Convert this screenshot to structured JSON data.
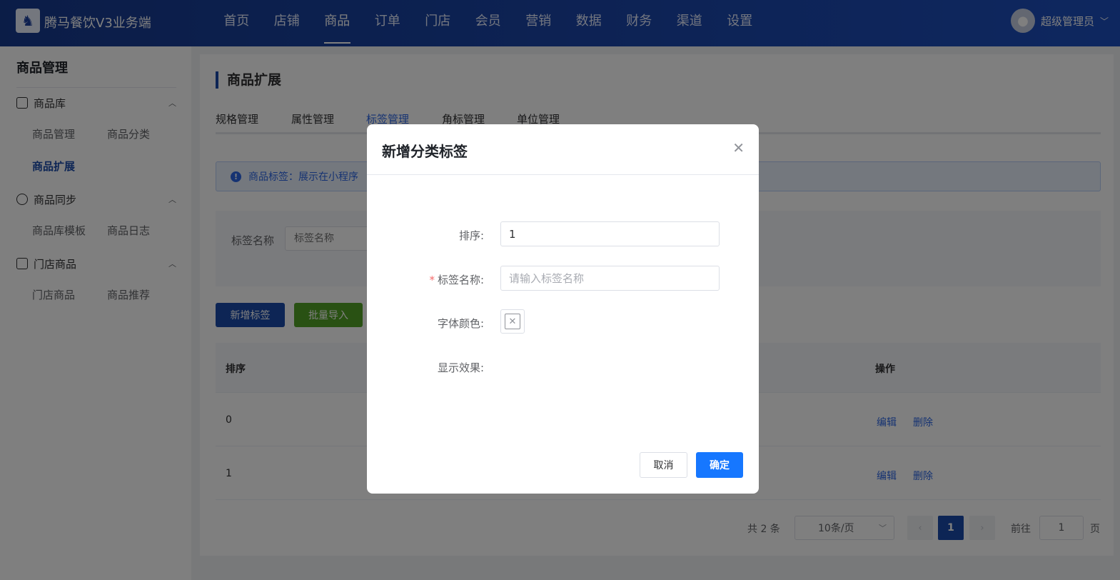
{
  "header": {
    "app_title": "腾马餐饮V3业务端",
    "nav": [
      {
        "label": "首页",
        "active": false
      },
      {
        "label": "店铺",
        "active": false
      },
      {
        "label": "商品",
        "active": true
      },
      {
        "label": "订单",
        "active": false
      },
      {
        "label": "门店",
        "active": false
      },
      {
        "label": "会员",
        "active": false
      },
      {
        "label": "营销",
        "active": false
      },
      {
        "label": "数据",
        "active": false
      },
      {
        "label": "财务",
        "active": false
      },
      {
        "label": "渠道",
        "active": false
      },
      {
        "label": "设置",
        "active": false
      }
    ],
    "user_name": "超级管理员",
    "logo_icon": "horse-logo-icon",
    "avatar_icon": "user-avatar-icon"
  },
  "sidebar": {
    "title": "商品管理",
    "groups": [
      {
        "label": "商品库",
        "icon": "bag-icon",
        "items": [
          "商品管理",
          "商品分类",
          "商品扩展"
        ]
      },
      {
        "label": "商品同步",
        "icon": "cloud-sync-icon",
        "items": [
          "商品库模板",
          "商品日志"
        ]
      },
      {
        "label": "门店商品",
        "icon": "store-bag-icon",
        "items": [
          "门店商品",
          "商品推荐"
        ]
      }
    ],
    "active_item": "商品扩展"
  },
  "main": {
    "page_title": "商品扩展",
    "tabs": [
      "规格管理",
      "属性管理",
      "标签管理",
      "角标管理",
      "单位管理"
    ],
    "active_tab": "标签管理",
    "alert_text": "商品标签：展示在小程序",
    "search": {
      "label": "标签名称",
      "placeholder": "标签名称"
    },
    "buttons": {
      "add": "新增标签",
      "import": "批量导入"
    },
    "table": {
      "columns": [
        "排序",
        "操作"
      ],
      "rows": [
        {
          "sort": "0",
          "actions": [
            "编辑",
            "删除"
          ]
        },
        {
          "sort": "1",
          "actions": [
            "编辑",
            "删除"
          ]
        }
      ]
    },
    "pagination": {
      "total": "共 2 条",
      "page_size": "10条/页",
      "current_page": "1",
      "goto_prefix": "前往",
      "goto_value": "1",
      "goto_suffix": "页"
    }
  },
  "dialog": {
    "title": "新增分类标签",
    "close_icon": "close-icon",
    "fields": {
      "sort": {
        "label": "排序:",
        "value": "1"
      },
      "name": {
        "label": "标签名称:",
        "placeholder": "请输入标签名称",
        "required_mark": "*"
      },
      "color": {
        "label": "字体颜色:"
      },
      "preview": {
        "label": "显示效果:"
      }
    },
    "cancel": "取消",
    "confirm": "确定"
  },
  "colors": {
    "primary": "#1b4aaa",
    "confirm": "#1677ff",
    "import": "#52a226",
    "required": "#f56c6c"
  }
}
